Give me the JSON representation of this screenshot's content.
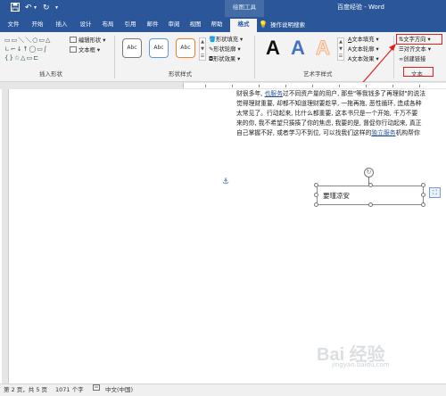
{
  "titlebar": {
    "save_icon": "save-icon",
    "undo_icon": "undo-icon",
    "redo_icon": "redo-icon",
    "customize_icon": "customize-qat-icon",
    "context_label": "绘图工具",
    "document_title": "百度经验 - Word"
  },
  "tabs": {
    "file": "文件",
    "home": "开始",
    "insert": "插入",
    "design": "设计",
    "layout": "布局",
    "references": "引用",
    "mailings": "邮件",
    "review": "审阅",
    "view": "视图",
    "help": "帮助",
    "format": "格式",
    "tell_me": "操作说明搜索",
    "tell_me_icon": "lightbulb-icon"
  },
  "ribbon": {
    "insert_shapes": {
      "label": "插入形状",
      "edit_shape": "编辑形状",
      "text_box": "文本框",
      "shape_glyphs_row1": "▭▭＼＼○▭△",
      "shape_glyphs_row2": "∟⌐↓↑◯▭∫",
      "shape_glyphs_row3": "{}☆△▭⊏"
    },
    "shape_styles": {
      "label": "形状样式",
      "style_sample": "Abc",
      "fill": "形状填充",
      "outline": "形状轮廓",
      "effects": "形状效果"
    },
    "wordart_styles": {
      "label": "艺术字样式",
      "letter": "A",
      "text_fill": "文本填充",
      "text_outline": "文本轮廓",
      "text_effects": "文本效果"
    },
    "text": {
      "label": "文本",
      "text_direction": "文字方向",
      "align_text": "对齐文本",
      "create_link": "创建链接"
    },
    "colors": {
      "accent": "#2b579a",
      "highlight_red": "#e01e1e",
      "wordart_blue": "#4472c4",
      "wordart_orange": "#f4b183"
    }
  },
  "document": {
    "lines": [
      {
        "before": "财很多年, ",
        "link": "也服务",
        "after": "过不同资产量的用户, 那些\"等我钱多了再理财\"的说法"
      },
      {
        "before": "觉得理财重要, 却都不知道理财要趁早, 一拖再拖, 恶性循环, 造成各种"
      },
      {
        "before": "太常见了。行动起来, 比什么都重要, 这本书只是一个开始, 千万不要"
      },
      {
        "before": "来的你, 我不希望只揍揍了你的焦虑, 我要的是, 督促你行动起来, 真正"
      },
      {
        "before": "自己掌握不好, 或者学习不到位, 可以找我们这样的",
        "link": "独立服务",
        "after": "机构帮你"
      }
    ],
    "textbox_text": "要瑾凉安",
    "anchor_icon": "anchor-icon",
    "rotate_icon": "rotate-handle-icon",
    "layout_options_icon": "layout-options-icon",
    "watermark": "Bai 经验",
    "watermark_sub": "jingyan.baidu.com"
  },
  "statusbar": {
    "page": "第 2 页，共 5 页",
    "words": "1071 个字",
    "proofing_icon": "proofing-icon",
    "language": "中文(中国)"
  }
}
